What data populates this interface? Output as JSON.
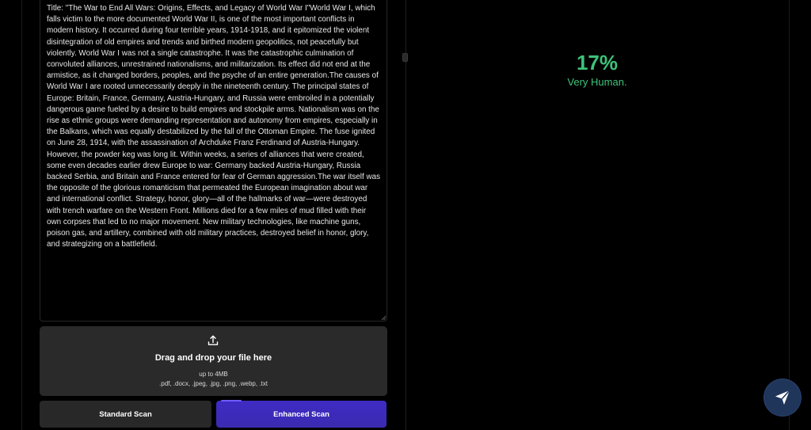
{
  "editor": {
    "text": "Title: \"The War to End All Wars: Origins, Effects, and Legacy of World War I\"World War I, which falls victim to the more documented World War II, is one of the most important conflicts in modern history. It occurred during four terrible years, 1914-1918, and it epitomized the violent disintegration of old empires and trends and birthed modern geopolitics, not peacefully but violently. World War I was not a single catastrophe. It was the catastrophic culmination of convoluted alliances, unrestrained nationalisms, and militarization. Its effect did not end at the armistice, as it changed borders, peoples, and the psyche of an entire generation.The causes of World War I are rooted unnecessarily deeply in the nineteenth century. The principal states of Europe: Britain, France, Germany, Austria-Hungary, and Russia were embroiled in a potentially dangerous game fueled by a desire to build empires and stockpile arms. Nationalism was on the rise as ethnic groups were demanding representation and autonomy from empires, especially in the Balkans, which was equally destabilized by the fall of the Ottoman Empire. The fuse ignited on June 28, 1914, with the assassination of Archduke Franz Ferdinand of Austria-Hungary. However, the powder keg was long lit. Within weeks, a series of alliances that were created, some even decades earlier drew Europe to war: Germany backed Austria-Hungary, Russia backed Serbia, and Britain and France entered for fear of German aggression.The war itself was the opposite of the glorious romanticism that permeated the European imagination about war and international conflict. Strategy, honor, glory—all of the hallmarks of war—were destroyed with trench warfare on the Western Front. Millions died for a few miles of mud filled with their own corpses that led to no major movement. New military technologies, like machine guns, poison gas, and artillery, combined with old military practices, destroyed belief in honor, glory, and strategizing on a battlefield."
  },
  "dropzone": {
    "icon": "upload-icon",
    "title": "Drag and drop your file here",
    "limit": "up to 4MB",
    "types": ".pdf, .docx, .jpeg, .jpg, .png, .webp, .txt"
  },
  "buttons": {
    "standard_label": "Standard Scan",
    "enhanced_label": "Enhanced Scan"
  },
  "result": {
    "score": "17%",
    "verdict": "Very Human."
  },
  "colors": {
    "accent": "#3a2bb0",
    "result_green": "#3ec37a",
    "fab_bg": "#20355a"
  },
  "fab": {
    "icon": "send-icon"
  }
}
